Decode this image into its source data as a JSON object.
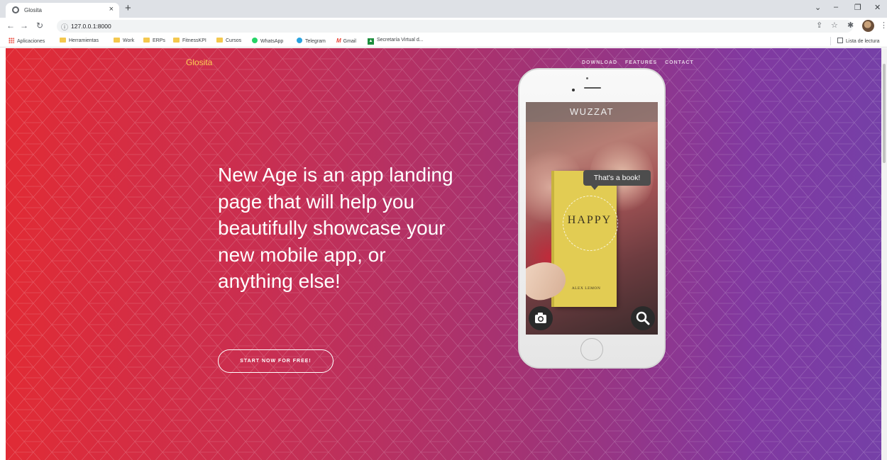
{
  "browser": {
    "tab_title": "Glosita",
    "tab_close": "×",
    "new_tab": "+",
    "url": "127.0.0.1:8000",
    "window_controls": [
      "⌄",
      "–",
      "❐",
      "✕"
    ]
  },
  "bookmarks": [
    {
      "label": "Aplicaciones",
      "icon": "apps-icon"
    },
    {
      "label": "Herramientas",
      "icon": "folder-icon"
    },
    {
      "label": "Work",
      "icon": "folder-icon"
    },
    {
      "label": "ERPs",
      "icon": "folder-icon"
    },
    {
      "label": "FitnessKPI",
      "icon": "folder-icon"
    },
    {
      "label": "Cursos",
      "icon": "folder-icon"
    },
    {
      "label": "WhatsApp",
      "icon": "whatsapp-icon"
    },
    {
      "label": "Telegram",
      "icon": "telegram-icon"
    },
    {
      "label": "Gmail",
      "icon": "gmail-icon"
    },
    {
      "label": "Secretaría Virtual d...",
      "icon": "secretaria-icon"
    }
  ],
  "reading_list": "Lista de lectura",
  "site": {
    "brand": "Glosita",
    "nav": [
      "DOWNLOAD",
      "FEATURES",
      "CONTACT"
    ],
    "headline": "New Age is an app landing page that will help you beautifully showcase your new mobile app, or anything else!",
    "cta": "START NOW FOR FREE!"
  },
  "phone": {
    "app_name": "WUZZAT",
    "bubble": "That's a book!",
    "book_title": "HAPPY",
    "book_author": "ALEX LEMON"
  },
  "colors": {
    "gradient_start": "#e12b35",
    "gradient_end": "#7540a7",
    "brand": "#fdcc52"
  }
}
